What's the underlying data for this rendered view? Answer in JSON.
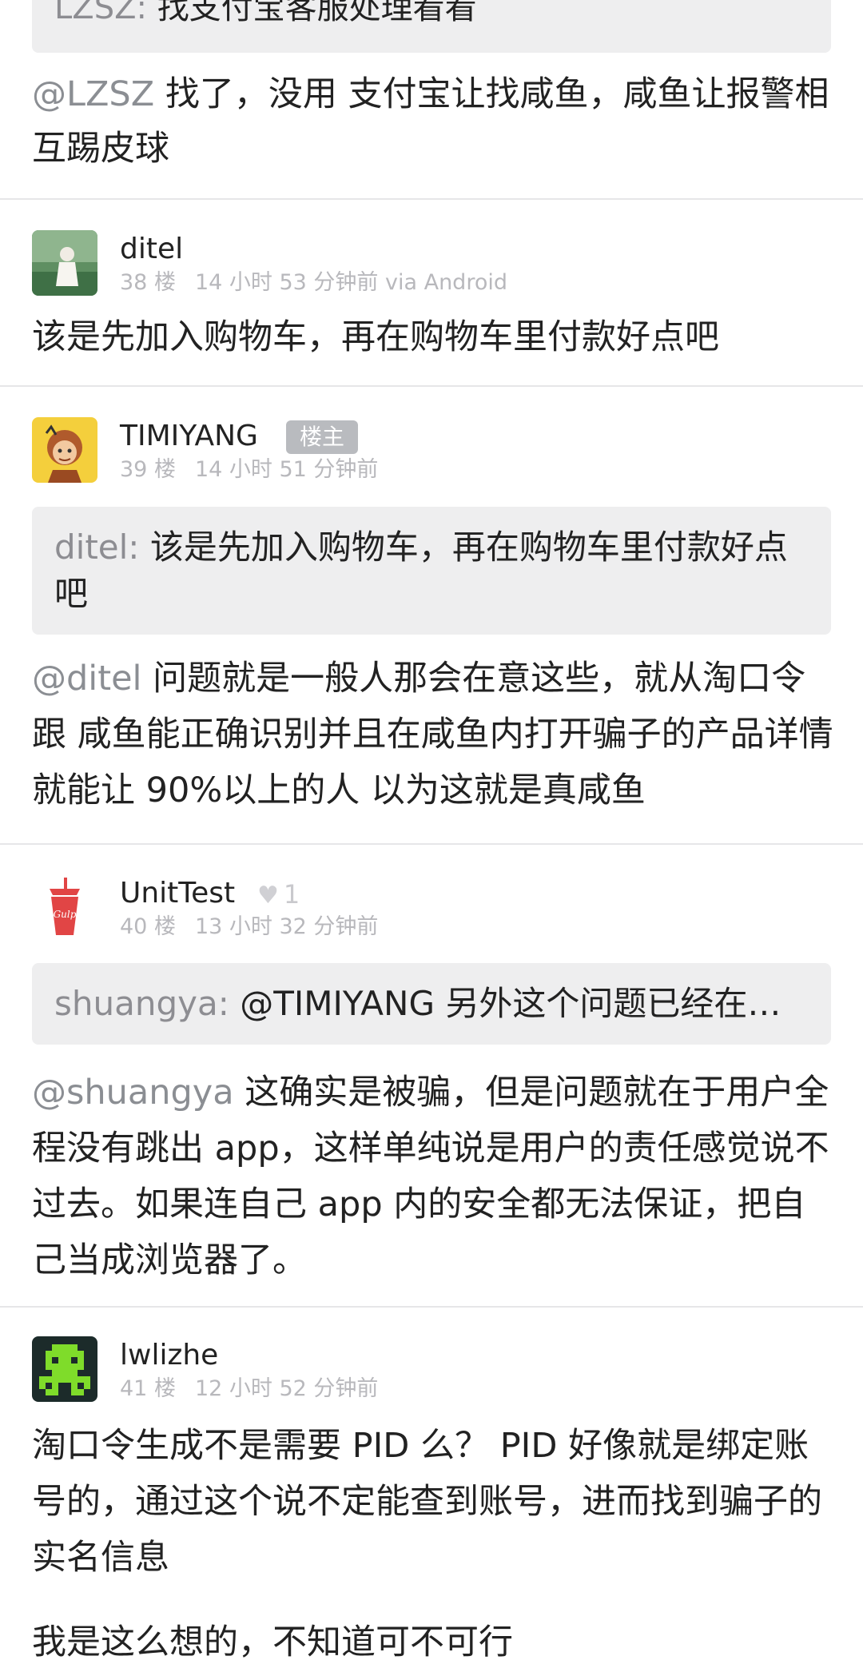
{
  "top_reply": {
    "quote_author": "LZSZ:",
    "quote_text": "找支付宝客服处理看看",
    "mention": "@LZSZ",
    "text": " 找了，没用 支付宝让找咸鱼，咸鱼让报警相互踢皮球"
  },
  "comments": [
    {
      "username": "ditel",
      "floor": "38 楼",
      "time": "14 小时 53 分钟前 via Android",
      "text": "该是先加入购物车，再在购物车里付款好点吧"
    },
    {
      "username": "TIMIYANG",
      "badge": "楼主",
      "floor": "39 楼",
      "time": "14 小时 51 分钟前",
      "quote_author": "ditel:",
      "quote_text": "该是先加入购物车，再在购物车里付款好点吧",
      "mention": "@ditel",
      "text": " 问题就是一般人那会在意这些，就从淘口令跟 咸鱼能正确识别并且在咸鱼内打开骗子的产品详情就能让 90%以上的人 以为这就是真咸鱼"
    },
    {
      "username": "UnitTest",
      "like_count": "1",
      "floor": "40 楼",
      "time": "13 小时 32 分钟前",
      "quote_author": "shuangya:",
      "quote_text": "@TIMIYANG 另外这个问题已经在…",
      "mention": "@shuangya",
      "text": " 这确实是被骗，但是问题就在于用户全程没有跳出 app，这样单纯说是用户的责任感觉说不过去。如果连自己 app 内的安全都无法保证，把自己当成浏览器了。"
    },
    {
      "username": "lwlizhe",
      "floor": "41 楼",
      "time": "12 小时 52 分钟前",
      "text_p1": "淘口令生成不是需要 PID 么？ PID 好像就是绑定账号的，通过这个说不定能查到账号，进而找到骗子的实名信息",
      "text_p2": "我是这么想的，不知道可不可行"
    }
  ]
}
